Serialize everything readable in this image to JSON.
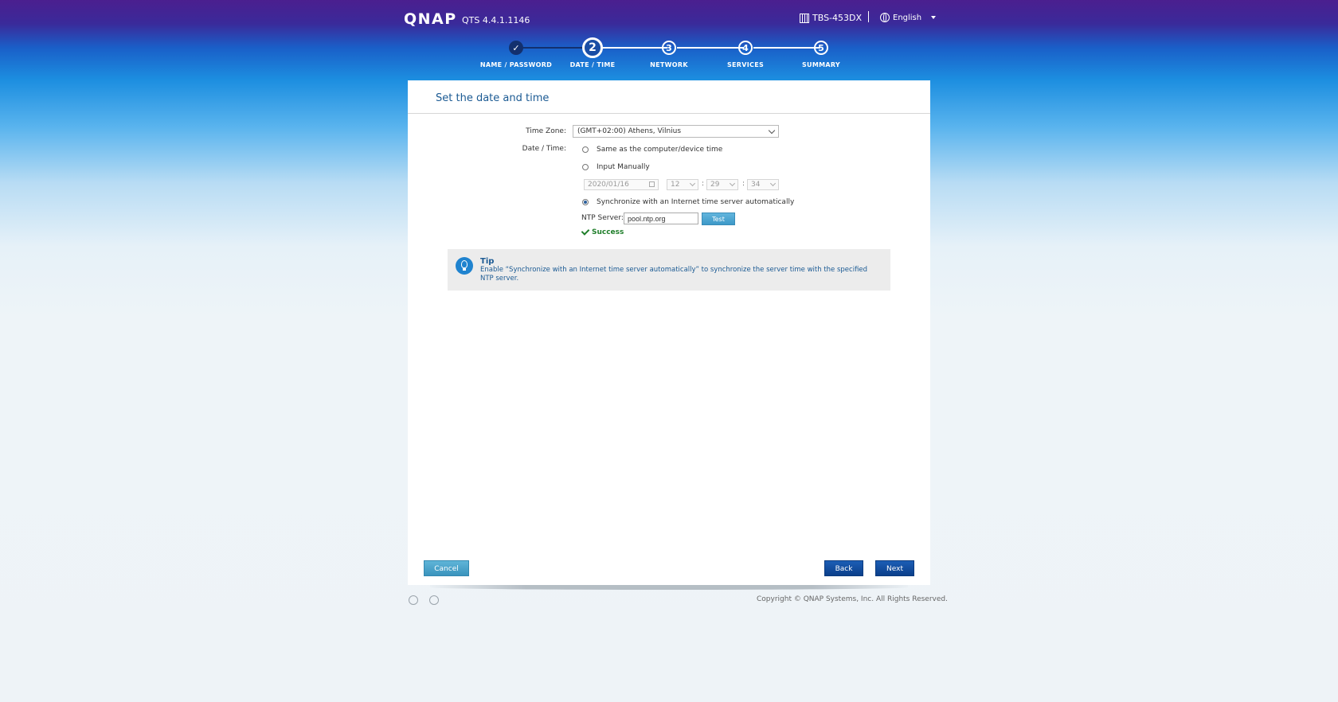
{
  "header": {
    "logo": "QNAP",
    "version": "QTS 4.4.1.1146",
    "device": "TBS-453DX",
    "language": "English"
  },
  "steps": [
    {
      "number": "✓",
      "label": "NAME / PASSWORD",
      "state": "done"
    },
    {
      "number": "2",
      "label": "DATE / TIME",
      "state": "current"
    },
    {
      "number": "3",
      "label": "NETWORK",
      "state": "pending"
    },
    {
      "number": "4",
      "label": "SERVICES",
      "state": "pending"
    },
    {
      "number": "5",
      "label": "SUMMARY",
      "state": "pending"
    }
  ],
  "panel": {
    "title": "Set the date and time",
    "timezone_label": "Time Zone:",
    "timezone_value": "(GMT+02:00) Athens, Vilnius",
    "datetime_label": "Date / Time:",
    "option_same": "Same as the computer/device time",
    "option_manual": "Input Manually",
    "manual_date": "2020/01/16",
    "manual_hour": "12",
    "manual_minute": "29",
    "manual_second": "34",
    "colon": ":",
    "option_sync": "Synchronize with an Internet time server automatically",
    "ntp_label": "NTP Server:",
    "ntp_value": "pool.ntp.org",
    "test_label": "Test",
    "status": "Success"
  },
  "tip": {
    "title": "Tip",
    "text": "Enable “Synchronize with an Internet time server automatically” to synchronize the server time with the specified NTP server."
  },
  "buttons": {
    "cancel": "Cancel",
    "back": "Back",
    "next": "Next"
  },
  "footer": {
    "copyright": "Copyright © QNAP Systems, Inc. All Rights Reserved."
  },
  "colors": {
    "accent": "#1b5a93",
    "success": "#1f7e2a"
  }
}
